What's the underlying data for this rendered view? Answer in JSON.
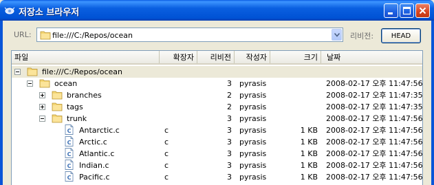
{
  "window": {
    "title": "저장소 브라우저",
    "minimize_icon": "minimize-icon",
    "maximize_icon": "maximize-icon",
    "close_icon": "close-icon"
  },
  "toolbar": {
    "url_label": "URL:",
    "url_value": "file:///C:/Repos/ocean",
    "revision_label": "리비전:",
    "head_button": "HEAD"
  },
  "columns": [
    "파일",
    "확장자",
    "리비전",
    "작성자",
    "크기",
    "날짜"
  ],
  "root": {
    "label": "file:///C:/Repos/ocean",
    "expanded": true
  },
  "rows": [
    {
      "name": "ocean",
      "type": "folder",
      "expander": "minus",
      "ext": "",
      "rev": "3",
      "author": "pyrasis",
      "size": "",
      "date": "2008-02-17 오후 11:47:56"
    },
    {
      "name": "branches",
      "type": "folder",
      "expander": "plus",
      "ext": "",
      "rev": "2",
      "author": "pyrasis",
      "size": "",
      "date": "2008-02-17 오후 11:47:35"
    },
    {
      "name": "tags",
      "type": "folder",
      "expander": "plus",
      "ext": "",
      "rev": "2",
      "author": "pyrasis",
      "size": "",
      "date": "2008-02-17 오후 11:47:35"
    },
    {
      "name": "trunk",
      "type": "folder",
      "expander": "minus",
      "ext": "",
      "rev": "3",
      "author": "pyrasis",
      "size": "",
      "date": "2008-02-17 오후 11:47:56"
    },
    {
      "name": "Antarctic.c",
      "type": "file",
      "expander": "",
      "ext": "c",
      "rev": "3",
      "author": "pyrasis",
      "size": "1 KB",
      "date": "2008-02-17 오후 11:47:56"
    },
    {
      "name": "Arctic.c",
      "type": "file",
      "expander": "",
      "ext": "c",
      "rev": "3",
      "author": "pyrasis",
      "size": "1 KB",
      "date": "2008-02-17 오후 11:47:56"
    },
    {
      "name": "Atlantic.c",
      "type": "file",
      "expander": "",
      "ext": "c",
      "rev": "3",
      "author": "pyrasis",
      "size": "1 KB",
      "date": "2008-02-17 오후 11:47:56"
    },
    {
      "name": "Indian.c",
      "type": "file",
      "expander": "",
      "ext": "c",
      "rev": "3",
      "author": "pyrasis",
      "size": "1 KB",
      "date": "2008-02-17 오후 11:47:56"
    },
    {
      "name": "Pacific.c",
      "type": "file",
      "expander": "",
      "ext": "c",
      "rev": "3",
      "author": "pyrasis",
      "size": "1 KB",
      "date": "2008-02-17 오후 11:47:56"
    }
  ],
  "colors": {
    "titlebar": "#0a5fe0",
    "window_bg": "#ece9d8",
    "folder": "#f4d675",
    "file_icon_blue": "#3a6fb5"
  }
}
